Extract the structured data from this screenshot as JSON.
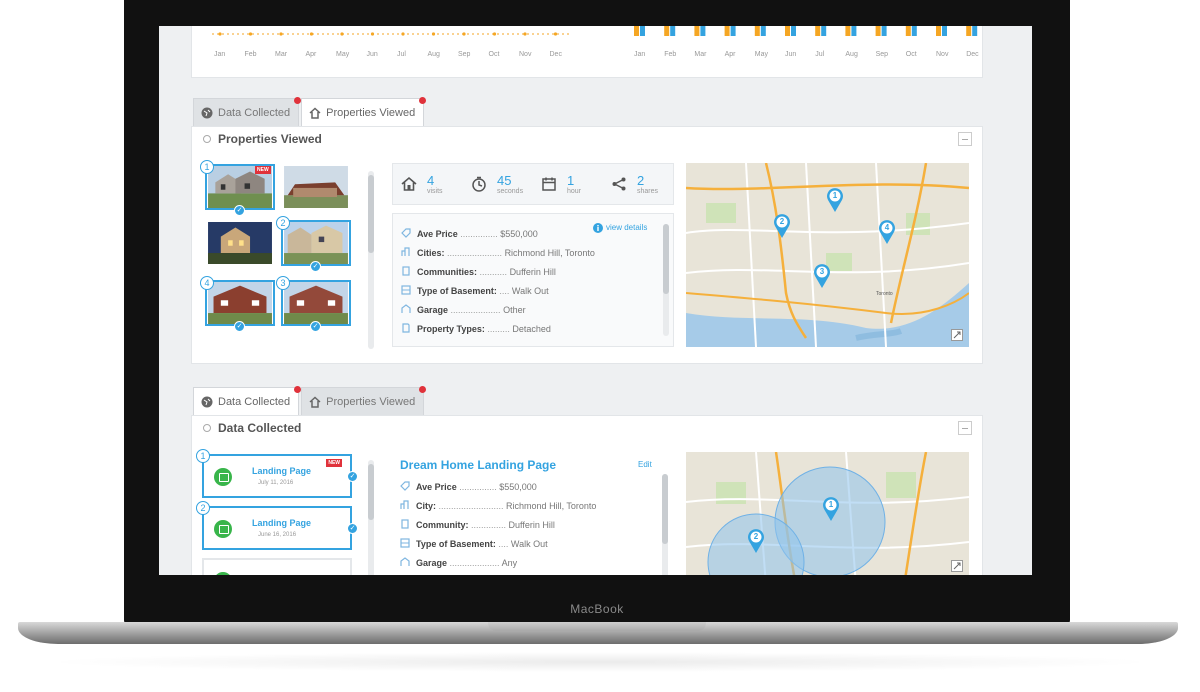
{
  "device": {
    "brand": "MacBook"
  },
  "top_chart": {
    "months_left": [
      "Jan",
      "Feb",
      "Mar",
      "Apr",
      "May",
      "Jun",
      "Jul",
      "Aug",
      "Sep",
      "Oct",
      "Nov",
      "Dec"
    ],
    "months_right": [
      "Jan",
      "Feb",
      "Mar",
      "Apr",
      "May",
      "Jun",
      "Jul",
      "Aug",
      "Sep",
      "Oct",
      "Nov",
      "Dec"
    ],
    "accent": "#f5a623",
    "accent2": "#34a3e0"
  },
  "section1": {
    "tabs": [
      {
        "label": "Data Collected",
        "icon": "globe-icon",
        "active": false
      },
      {
        "label": "Properties Viewed",
        "icon": "home-icon",
        "active": true
      }
    ],
    "title": "Properties Viewed",
    "thumbnails": [
      {
        "badge": "1",
        "selected": true,
        "new": true,
        "new_label": "NEW"
      },
      {
        "badge": "",
        "selected": false,
        "new": false
      },
      {
        "badge": "",
        "selected": false,
        "new": false
      },
      {
        "badge": "2",
        "selected": true,
        "new": false
      },
      {
        "badge": "4",
        "selected": true,
        "new": false
      },
      {
        "badge": "3",
        "selected": true,
        "new": false
      }
    ],
    "stats": [
      {
        "icon": "home-icon",
        "value": "4",
        "label": "visits"
      },
      {
        "icon": "timer-icon",
        "value": "45",
        "label": "seconds"
      },
      {
        "icon": "calendar-icon",
        "value": "1",
        "label": "hour"
      },
      {
        "icon": "share-icon",
        "value": "2",
        "label": "shares"
      }
    ],
    "view_details": "view details",
    "details": [
      {
        "icon": "tag-icon",
        "label": "Ave Price",
        "dots": "...............",
        "value": "$550,000"
      },
      {
        "icon": "city-icon",
        "label": "Cities:",
        "dots": "......................",
        "value": "Richmond Hill, Toronto"
      },
      {
        "icon": "building-icon",
        "label": "Communities:",
        "dots": "...........",
        "value": "Dufferin Hill"
      },
      {
        "icon": "basement-icon",
        "label": "Type of Basement:",
        "dots": "....",
        "value": "Walk Out"
      },
      {
        "icon": "garage-icon",
        "label": "Garage",
        "dots": "....................",
        "value": "Other"
      },
      {
        "icon": "doc-icon",
        "label": "Property Types:",
        "dots": ".........",
        "value": "Detached"
      }
    ],
    "map_pins": [
      "1",
      "2",
      "3",
      "4"
    ]
  },
  "section2": {
    "tabs": [
      {
        "label": "Data Collected",
        "icon": "globe-icon",
        "active": true
      },
      {
        "label": "Properties Viewed",
        "icon": "home-icon",
        "active": false
      }
    ],
    "title": "Data Collected",
    "landing_pages": [
      {
        "badge": "1",
        "title": "Landing Page",
        "date": "July 11, 2016",
        "new": true,
        "new_label": "NEW"
      },
      {
        "badge": "2",
        "title": "Landing Page",
        "date": "June 16, 2016",
        "new": false
      }
    ],
    "detail_title": "Dream Home Landing Page",
    "edit_label": "Edit",
    "details": [
      {
        "icon": "tag-icon",
        "label": "Ave Price",
        "dots": "...............",
        "value": "$550,000"
      },
      {
        "icon": "city-icon",
        "label": "City:",
        "dots": "..........................",
        "value": "Richmond Hill, Toronto"
      },
      {
        "icon": "building-icon",
        "label": "Community:",
        "dots": "..............",
        "value": "Dufferin Hill"
      },
      {
        "icon": "basement-icon",
        "label": "Type of Basement:",
        "dots": "....",
        "value": "Walk Out"
      },
      {
        "icon": "garage-icon",
        "label": "Garage",
        "dots": "....................",
        "value": "Any"
      }
    ],
    "map_pins": [
      "1",
      "2"
    ]
  }
}
